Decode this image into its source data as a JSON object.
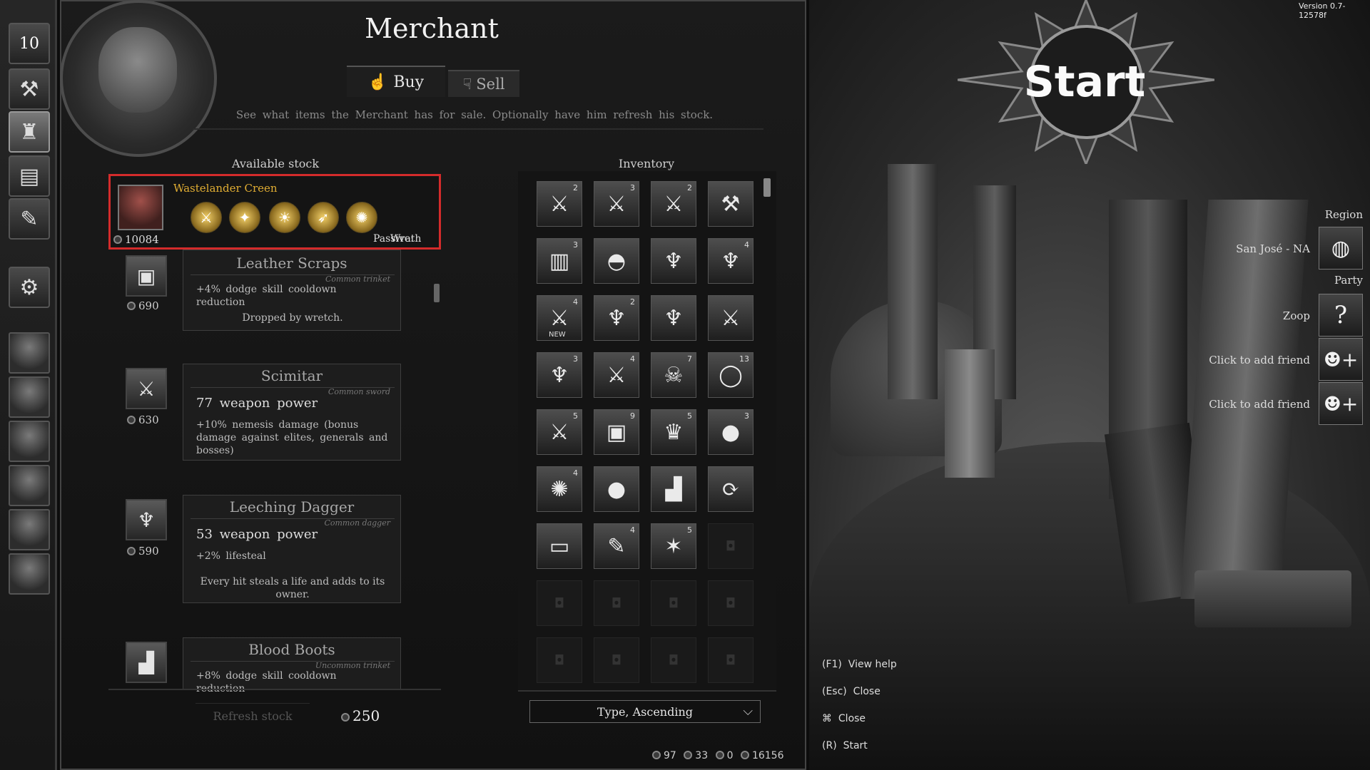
{
  "window": {
    "version": "Version  0.7-12578f"
  },
  "sidebar": {
    "level": "10",
    "icons": [
      "hammer-icon",
      "pouch-icon",
      "chest-icon",
      "quill-icon",
      "gear-icon"
    ],
    "portraits": [
      "hero-1",
      "hero-2",
      "hero-3",
      "hero-4",
      "hero-5",
      "hero-6"
    ]
  },
  "merchant": {
    "title": "Merchant",
    "tabs": [
      {
        "label": "Buy",
        "icon": "☝"
      },
      {
        "label": "Sell",
        "icon": "☟"
      }
    ],
    "subtitle": "See what items the Merchant has for sale. Optionally have him refresh his stock.",
    "stock_heading": "Available stock",
    "inventory_heading": "Inventory",
    "featured": {
      "name": "Wastelander Creen",
      "price": "10084",
      "passive_label": "Passive:",
      "passive_value": "Wrath",
      "runes": [
        "⚔",
        "✦",
        "☀",
        "➶",
        "✺"
      ]
    },
    "items": [
      {
        "name": "Leather Scraps",
        "type": "Common trinket",
        "stat": "+4% dodge skill cooldown reduction",
        "desc": "Dropped by wretch.",
        "price": "690",
        "icon": "▣"
      },
      {
        "name": "Scimitar",
        "type": "Common sword",
        "big": "77 weapon power",
        "stat": "+10% nemesis damage (bonus damage against elites, generals and bosses)",
        "price": "630",
        "icon": "⚔"
      },
      {
        "name": "Leeching Dagger",
        "type": "Common dagger",
        "big": "53 weapon power",
        "stat": "+2% lifesteal",
        "desc": "Every hit steals a life and adds to its owner.",
        "price": "590",
        "icon": "♆"
      },
      {
        "name": "Blood Boots",
        "type": "Uncommon trinket",
        "stat": "+8% dodge skill cooldown reduction",
        "icon": "▟"
      }
    ],
    "refresh_label": "Refresh stock",
    "refresh_cost": "250",
    "sort_label": "Type, Ascending",
    "inventory": [
      {
        "icon": "⚔",
        "count": "2"
      },
      {
        "icon": "⚔",
        "count": "3"
      },
      {
        "icon": "⚔",
        "count": "2"
      },
      {
        "icon": "⚒",
        "count": ""
      },
      {
        "icon": "▥",
        "count": "3"
      },
      {
        "icon": "◓",
        "count": ""
      },
      {
        "icon": "♆",
        "count": ""
      },
      {
        "icon": "♆",
        "count": "4"
      },
      {
        "icon": "⚔",
        "count": "4",
        "new": "NEW"
      },
      {
        "icon": "♆",
        "count": "2"
      },
      {
        "icon": "♆",
        "count": ""
      },
      {
        "icon": "⚔",
        "count": ""
      },
      {
        "icon": "♆",
        "count": "3"
      },
      {
        "icon": "⚔",
        "count": "4"
      },
      {
        "icon": "☠",
        "count": "7"
      },
      {
        "icon": "◯",
        "count": "13"
      },
      {
        "icon": "⚔",
        "count": "5"
      },
      {
        "icon": "▣",
        "count": "9"
      },
      {
        "icon": "♛",
        "count": "5"
      },
      {
        "icon": "●",
        "count": "3"
      },
      {
        "icon": "✺",
        "count": "4"
      },
      {
        "icon": "●",
        "count": ""
      },
      {
        "icon": "▟",
        "count": ""
      },
      {
        "icon": "⟳",
        "count": ""
      },
      {
        "icon": "▭",
        "count": ""
      },
      {
        "icon": "✎",
        "count": "4"
      },
      {
        "icon": "✶",
        "count": "5"
      },
      {
        "icon": "",
        "count": "",
        "empty": true
      },
      {
        "icon": "",
        "count": "",
        "empty": true
      },
      {
        "icon": "",
        "count": "",
        "empty": true
      },
      {
        "icon": "",
        "count": "",
        "empty": true
      },
      {
        "icon": "",
        "count": "",
        "empty": true
      },
      {
        "icon": "",
        "count": "",
        "empty": true
      },
      {
        "icon": "",
        "count": "",
        "empty": true
      },
      {
        "icon": "",
        "count": "",
        "empty": true
      },
      {
        "icon": "",
        "count": "",
        "empty": true
      }
    ],
    "currencies": [
      {
        "icon": "coin",
        "value": "97"
      },
      {
        "icon": "shard",
        "value": "33"
      },
      {
        "icon": "orb",
        "value": "0"
      },
      {
        "icon": "gold",
        "value": "16156"
      }
    ]
  },
  "right": {
    "start": "Start",
    "region_label": "Region",
    "region_value": "San José - NA",
    "party_label": "Party",
    "party": [
      {
        "name": "Zoop",
        "icon": "?"
      },
      {
        "name": "Click to add friend",
        "icon": "add-friend"
      },
      {
        "name": "Click to add friend",
        "icon": "add-friend"
      }
    ],
    "help": [
      {
        "key": "(F1)",
        "label": "View help"
      },
      {
        "key": "(Esc)",
        "label": "Close"
      },
      {
        "key": "mouse-icon",
        "label": "Close"
      },
      {
        "key": "(R)",
        "label": "Start"
      }
    ]
  }
}
